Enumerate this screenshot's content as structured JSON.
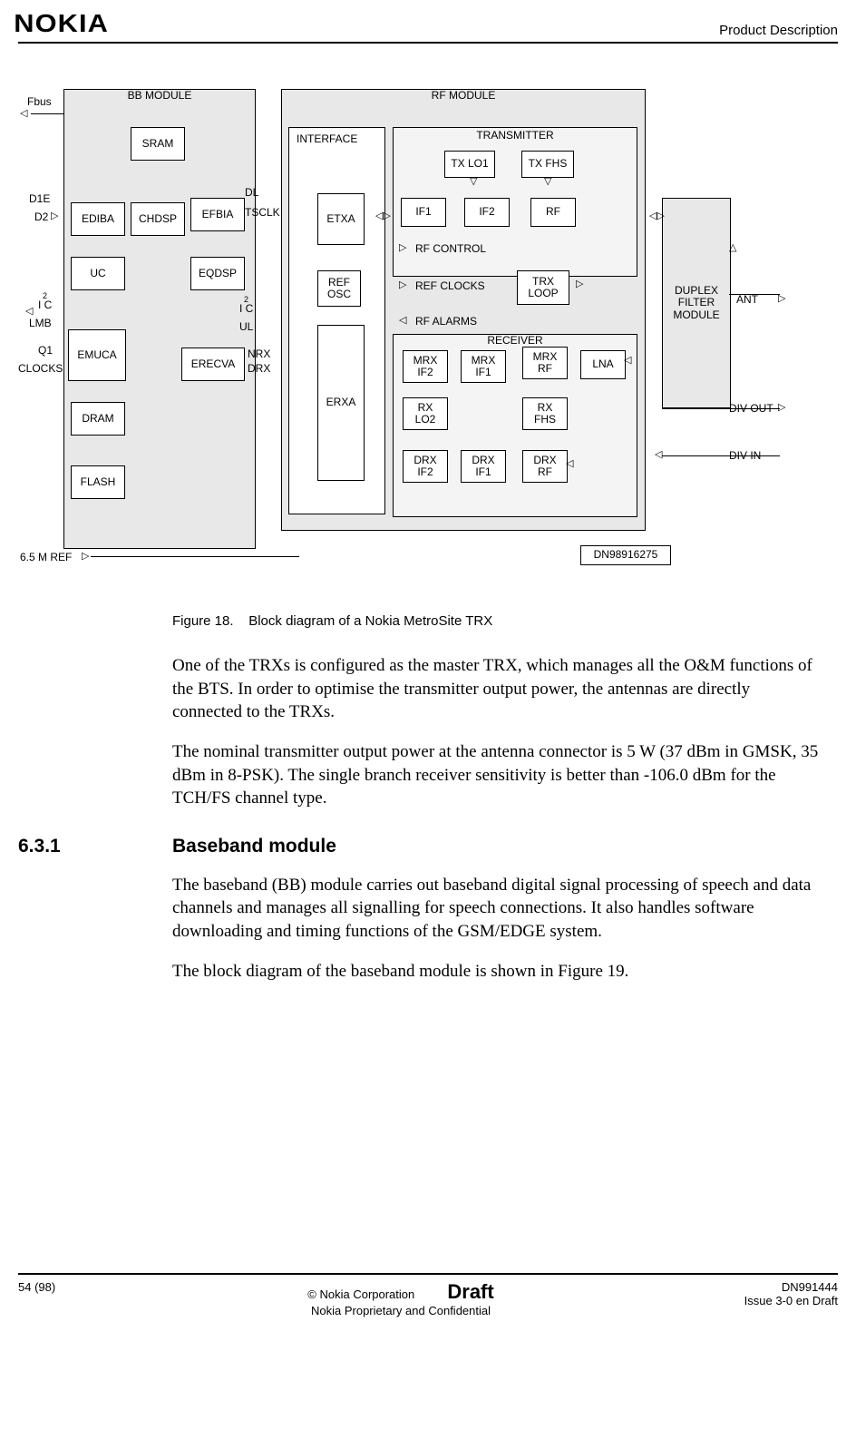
{
  "header": {
    "logo": "NOKIA",
    "right": "Product Description"
  },
  "diagram": {
    "sideLabels": {
      "fbus": "Fbus",
      "d1e": "D1E",
      "d2": "D2",
      "i2c_top": "I C",
      "i2c_top_sup": "2",
      "lmb": "LMB",
      "q1": "Q1",
      "clocks": "CLOCKS",
      "ref65": "6.5 M REF"
    },
    "bbModule": {
      "title": "BB MODULE",
      "sram": "SRAM",
      "ediba": "EDIBA",
      "chdsp": "CHDSP",
      "efbia": "EFBIA",
      "uc": "UC",
      "eqdsp": "EQDSP",
      "emuca": "EMUCA",
      "erecva": "ERECVA",
      "dram": "DRAM",
      "flash": "FLASH"
    },
    "signals": {
      "dl": "DL",
      "tsclk": "TSCLK",
      "i2c_r": "I C",
      "i2c_r_sup": "2",
      "ul": "UL",
      "nrx": "NRX",
      "drx": "DRX",
      "rf_control": "RF CONTROL",
      "ref_clocks": "REF CLOCKS",
      "rf_alarms": "RF ALARMS"
    },
    "rfModule": {
      "title": "RF MODULE",
      "interface": "INTERFACE",
      "transmitter": "TRANSMITTER",
      "receiver": "RECEIVER",
      "etxa": "ETXA",
      "refosc": "REF\nOSC",
      "erxa": "ERXA",
      "txlo1": "TX LO1",
      "txfhs": "TX FHS",
      "if1": "IF1",
      "if2": "IF2",
      "rf": "RF",
      "trxloop": "TRX\nLOOP",
      "mrxif2": "MRX\nIF2",
      "mrxif1": "MRX\nIF1",
      "mrxrf": "MRX\nRF",
      "lna": "LNA",
      "rxlo2": "RX\nLO2",
      "rxfhs": "RX\nFHS",
      "drxif2": "DRX\nIF2",
      "drxif1": "DRX\nIF1",
      "drxrf": "DRX\nRF"
    },
    "duplex": {
      "text": "DUPLEX\nFILTER\nMODULE",
      "ant": "ANT",
      "divout": "DIV OUT",
      "divin": "DIV IN"
    },
    "docnum": "DN98916275"
  },
  "figure": {
    "label": "Figure 18.",
    "caption": "Block diagram of a Nokia MetroSite TRX"
  },
  "paragraphs": {
    "p1": "One of the TRXs is configured as the master TRX, which manages all the O&M functions of the BTS. In order to optimise the transmitter output power, the antennas are directly connected to the TRXs.",
    "p2": "The nominal transmitter output power at the antenna connector is 5 W (37 dBm in GMSK, 35 dBm in 8-PSK). The single branch receiver sensitivity is better than -106.0 dBm for the TCH/FS channel type."
  },
  "section": {
    "num": "6.3.1",
    "title": "Baseband module",
    "p1": "The baseband (BB) module carries out baseband digital signal processing of speech and data channels and manages all signalling for speech connections. It also handles software downloading and timing functions of the GSM/EDGE system.",
    "p2": "The block diagram of the baseband module is shown in Figure 19."
  },
  "footer": {
    "left": "54 (98)",
    "center1": "© Nokia Corporation",
    "draft": "Draft",
    "center2": "Nokia Proprietary and Confidential",
    "right1": "DN991444",
    "right2": "Issue 3-0 en Draft"
  }
}
